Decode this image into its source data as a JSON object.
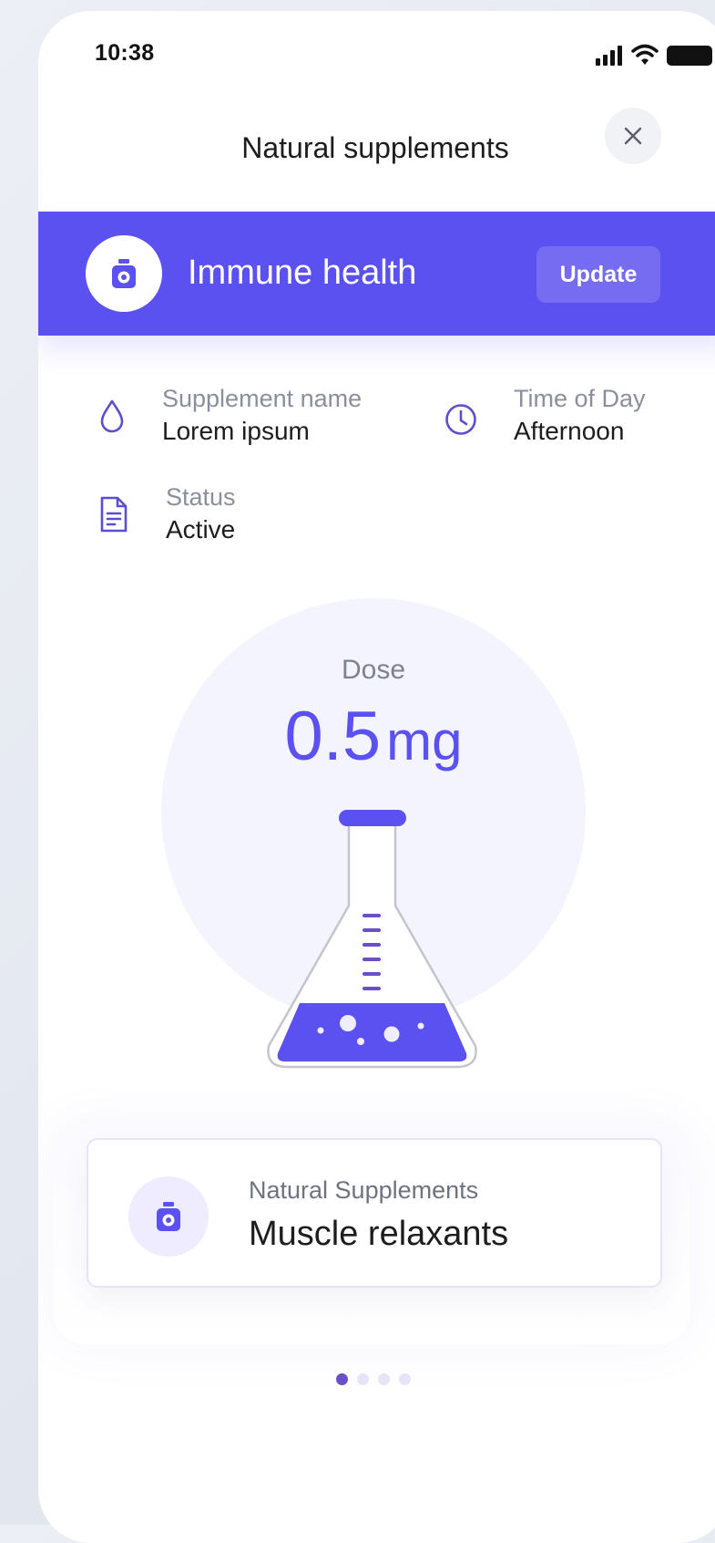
{
  "status_bar": {
    "time": "10:38"
  },
  "header": {
    "title": "Natural supplements",
    "close_icon": "close-icon"
  },
  "banner": {
    "icon": "supplement-bottle-icon",
    "title": "Immune health",
    "update_label": "Update"
  },
  "details": {
    "supplement_name": {
      "label": "Supplement name",
      "value": "Lorem ipsum",
      "icon": "drop-icon"
    },
    "time_of_day": {
      "label": "Time of Day",
      "value": "Afternoon",
      "icon": "clock-icon"
    },
    "status": {
      "label": "Status",
      "value": "Active",
      "icon": "document-icon"
    }
  },
  "dose": {
    "label": "Dose",
    "value": "0.5",
    "unit": "mg",
    "illustration": "flask-illustration"
  },
  "card": {
    "subtitle": "Natural Supplements",
    "title": "Muscle relaxants",
    "icon": "supplement-bottle-icon"
  },
  "pager": {
    "count": 4,
    "active_index": 0
  },
  "colors": {
    "accent": "#5b50f0",
    "pager_active": "#6a4fc8"
  }
}
